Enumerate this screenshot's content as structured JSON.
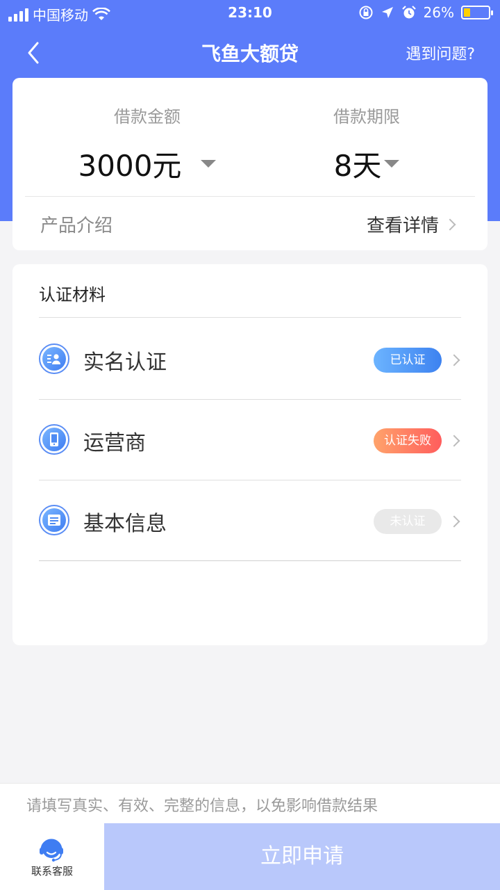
{
  "status_bar": {
    "carrier": "中国移动",
    "time": "23:10",
    "battery_percent": "26%",
    "battery_level": 0.26
  },
  "nav": {
    "title": "飞鱼大额贷",
    "help": "遇到问题?"
  },
  "loan": {
    "amount_label": "借款金额",
    "amount_value": "3000元",
    "term_label": "借款期限",
    "term_value": "8天"
  },
  "product": {
    "label": "产品介绍",
    "detail": "查看详情"
  },
  "verification": {
    "title": "认证材料",
    "items": [
      {
        "label": "实名认证",
        "status": "已认证",
        "status_type": "ok",
        "icon": "id-card-icon"
      },
      {
        "label": "运营商",
        "status": "认证失败",
        "status_type": "fail",
        "icon": "phone-icon"
      },
      {
        "label": "基本信息",
        "status": "未认证",
        "status_type": "none",
        "icon": "info-list-icon"
      }
    ]
  },
  "notice": "请填写真实、有效、完整的信息，以免影响借款结果",
  "footer": {
    "customer_service": "联系客服",
    "apply": "立即申请"
  },
  "colors": {
    "primary": "#5b7cfa",
    "apply_button": "#b9c8fb",
    "badge_ok": "#3d82f0",
    "badge_fail": "#ff5d5d",
    "badge_none": "#e9e9e9"
  }
}
